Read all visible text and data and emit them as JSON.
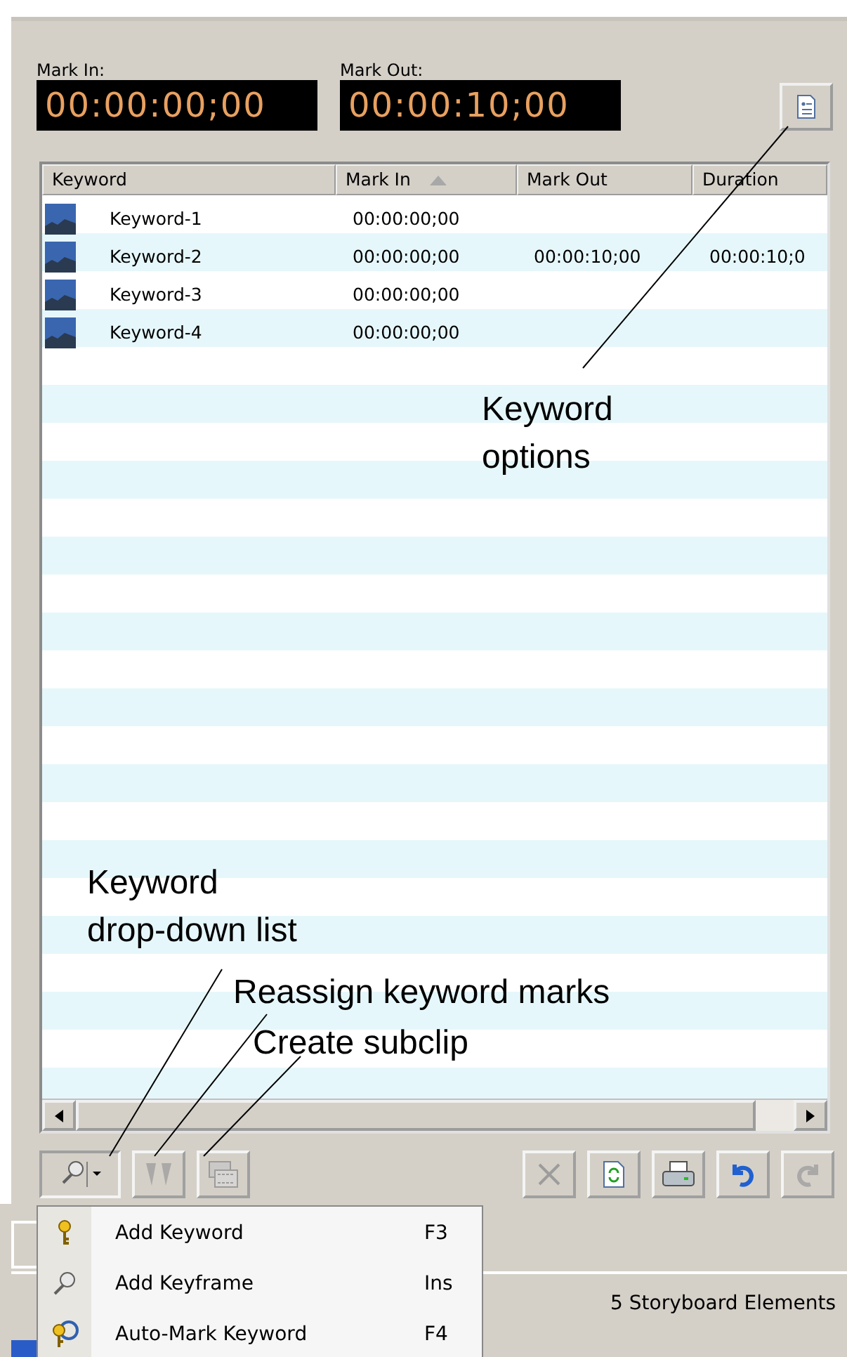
{
  "mark_in": {
    "label": "Mark In:",
    "timecode": "00:00:00;00"
  },
  "mark_out": {
    "label": "Mark Out:",
    "timecode": "00:00:10;00"
  },
  "table": {
    "columns": [
      {
        "label": "Keyword",
        "sorted": false
      },
      {
        "label": "Mark In",
        "sorted": true
      },
      {
        "label": "Mark Out",
        "sorted": false
      },
      {
        "label": "Duration",
        "sorted": false
      }
    ],
    "rows": [
      {
        "keyword": "Keyword-1",
        "mark_in": "00:00:00;00",
        "mark_out": "",
        "duration": ""
      },
      {
        "keyword": "Keyword-2",
        "mark_in": "00:00:00;00",
        "mark_out": "00:00:10;00",
        "duration": "00:00:10;0"
      },
      {
        "keyword": "Keyword-3",
        "mark_in": "00:00:00;00",
        "mark_out": "",
        "duration": ""
      },
      {
        "keyword": "Keyword-4",
        "mark_in": "00:00:00;00",
        "mark_out": "",
        "duration": ""
      }
    ]
  },
  "toolbar_left": [
    {
      "kind": "keyword",
      "disabled": false
    },
    {
      "kind": "reassign",
      "disabled": true
    },
    {
      "kind": "subclip",
      "disabled": true
    }
  ],
  "toolbar_right": [
    {
      "kind": "delete",
      "disabled": true
    },
    {
      "kind": "refresh",
      "disabled": false
    },
    {
      "kind": "print",
      "disabled": false
    },
    {
      "kind": "undo",
      "disabled": false
    },
    {
      "kind": "redo",
      "disabled": true
    }
  ],
  "menu": [
    {
      "kind": "key",
      "label": "Add Keyword",
      "shortcut": "F3"
    },
    {
      "kind": "pin",
      "label": "Add Keyframe",
      "shortcut": "Ins"
    },
    {
      "kind": "automark",
      "label": "Auto-Mark Keyword",
      "shortcut": "F4"
    }
  ],
  "status_bar": "5 Storyboard Elements",
  "callouts": [
    {
      "text": "Keyword\noptions"
    },
    {
      "text": "Keyword\ndrop-down list"
    },
    {
      "text": "Reassign keyword marks"
    },
    {
      "text": "Create subclip"
    }
  ]
}
